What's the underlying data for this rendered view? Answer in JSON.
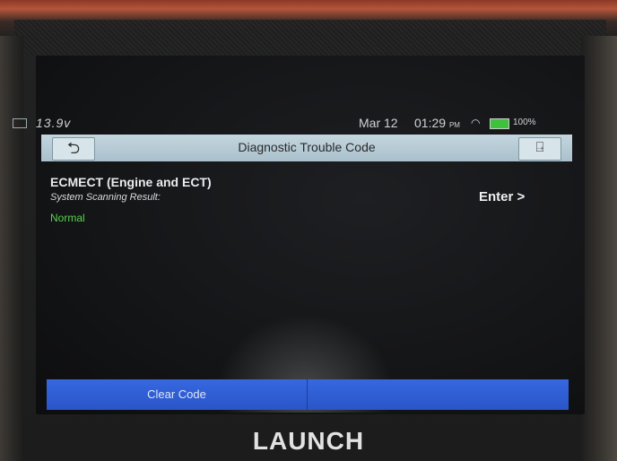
{
  "statusbar": {
    "voltage": "13.9v",
    "date": "Mar 12",
    "time": "01:29",
    "ampm": "PM",
    "battery_pct": "100%"
  },
  "header": {
    "title": "Diagnostic Trouble Code"
  },
  "main": {
    "system_name": "ECMECT (Engine and ECT)",
    "scan_label": "System Scanning Result:",
    "scan_result": "Normal",
    "enter_label": "Enter >"
  },
  "footer": {
    "clear_code_label": "Clear Code"
  },
  "device": {
    "brand": "LAUNCH"
  },
  "colors": {
    "accent_blue": "#2f5fd8",
    "normal_green": "#55d44b",
    "titlebar": "#b7cbd5"
  },
  "icons": {
    "back": "back-arrow-icon",
    "exit": "exit-icon",
    "wifi": "wifi-icon",
    "battery": "battery-icon",
    "vehicle_battery": "vehicle-battery-icon"
  }
}
